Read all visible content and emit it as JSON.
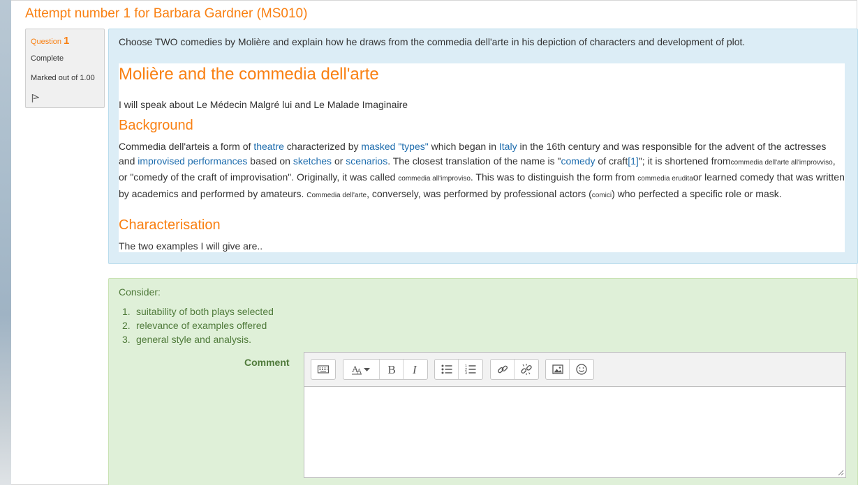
{
  "page": {
    "title": "Attempt number 1 for Barbara Gardner (MS010)"
  },
  "question_info": {
    "question_label": "Question",
    "question_number": "1",
    "state": "Complete",
    "grade": "Marked out of 1.00",
    "flag_icon": "flag-icon"
  },
  "question": {
    "text": "Choose TWO comedies by Molière and explain how he draws from the commedia dell'arte in his depiction of characters and development of plot."
  },
  "answer": {
    "heading": "Molière and the commedia dell'arte",
    "intro": "I will speak about Le Médecin Malgré lui and Le Malade Imaginaire",
    "background_heading": "Background",
    "background": {
      "t1": "Commedia dell'arteis a form of ",
      "link_theatre": "theatre",
      "t2": " characterized by ",
      "link_masked": "masked \"types\"",
      "t3": " which began in ",
      "link_italy": "Italy",
      "t4": " in the 16th century and was responsible for the advent of the actresses and ",
      "link_improvised": "improvised performances",
      "t5": " based on ",
      "link_sketches": "sketches",
      "t6": " or ",
      "link_scenarios": "scenarios",
      "t7": ". The closest translation of the name is \"",
      "link_comedy": "comedy",
      "t8": " of craft",
      "link_ref": "[1]",
      "t9": "\"; it is shortened from",
      "small1": "commedia dell'arte all'improvviso",
      "t10": ", or \"comedy of the craft of improvisation\". Originally, it was called ",
      "small2": "commedia all'improviso",
      "t11": ". This was to distinguish the form from ",
      "small3": "commedia erudita",
      "t12": "or learned comedy that was written by academics and performed by amateurs. ",
      "small4": "Commedia dell'arte",
      "t13": ", conversely, was performed by professional actors (",
      "small5": "comici",
      "t14": ") who perfected a specific role or mask."
    },
    "char_heading": "Characterisation",
    "char_text": "The two examples I will give are.."
  },
  "comment_section": {
    "consider_label": "Consider:",
    "items": [
      {
        "num": "1.",
        "text": "suitability of both plays selected"
      },
      {
        "num": "2.",
        "text": "relevance of examples offered"
      },
      {
        "num": "3.",
        "text": "general style and analysis."
      }
    ],
    "comment_label": "Comment",
    "editor_value": "",
    "toolbar_icons": [
      "toolbar-toggle-icon",
      "font-size-icon",
      "bold-icon",
      "italic-icon",
      "unordered-list-icon",
      "ordered-list-icon",
      "link-icon",
      "unlink-icon",
      "image-icon",
      "emoticon-icon"
    ]
  },
  "colors": {
    "accent_orange": "#f98012",
    "link_blue": "#1d6cad",
    "question_bg": "#dcedf6",
    "comment_bg": "#dff0d8",
    "comment_text": "#4f7a3a"
  }
}
